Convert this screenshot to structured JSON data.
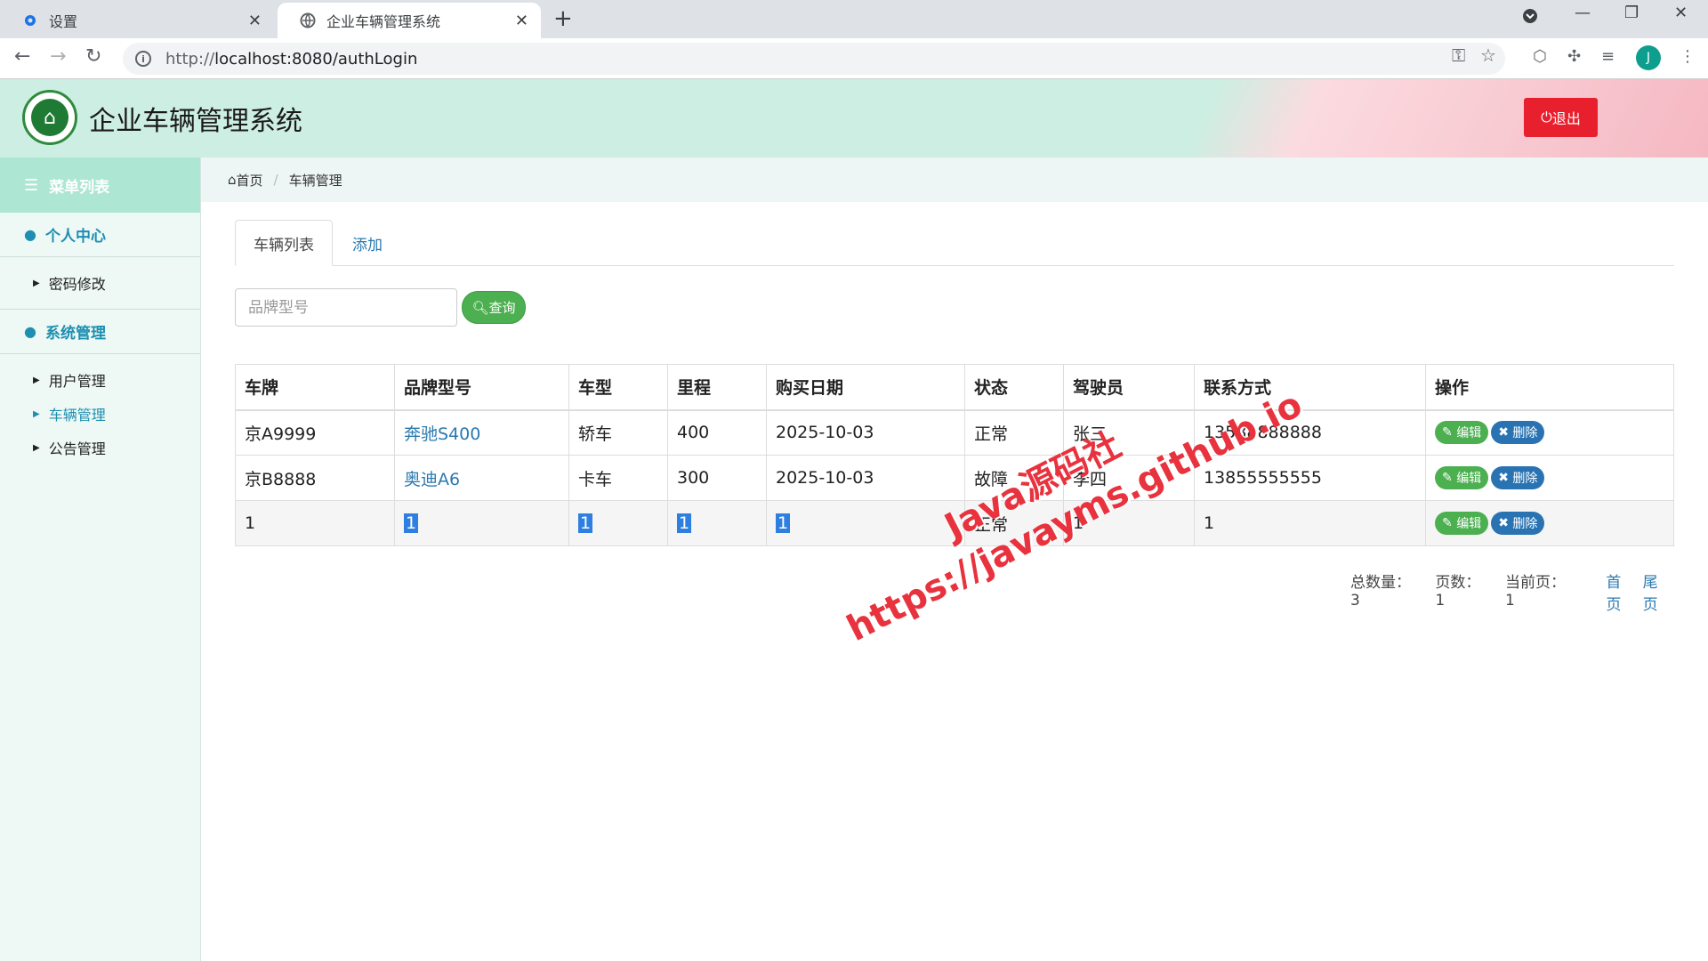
{
  "browser": {
    "tabs": [
      {
        "title": "设置",
        "icon": "gear-icon"
      },
      {
        "title": "企业车辆管理系统",
        "icon": "globe-icon"
      }
    ],
    "url_scheme": "http://",
    "url_rest": "localhost:8080/authLogin",
    "profile_initial": "J"
  },
  "header": {
    "title": "企业车辆管理系统",
    "logout_label": "退出",
    "logout_color": "#e8202e"
  },
  "sidebar": {
    "menu_title": "菜单列表",
    "groups": [
      {
        "title": "个人中心",
        "items": [
          "密码修改"
        ]
      },
      {
        "title": "系统管理",
        "items": [
          "用户管理",
          "车辆管理",
          "公告管理"
        ],
        "active": "车辆管理"
      }
    ]
  },
  "breadcrumb": {
    "home": "首页",
    "current": "车辆管理"
  },
  "content_tabs": {
    "list": "车辆列表",
    "add": "添加"
  },
  "search": {
    "placeholder": "品牌型号",
    "button": "查询"
  },
  "table": {
    "headers": [
      "车牌",
      "品牌型号",
      "车型",
      "里程",
      "购买日期",
      "状态",
      "驾驶员",
      "联系方式",
      "操作"
    ],
    "rows": [
      [
        "京A9999",
        "奔驰S400",
        "轿车",
        "400",
        "2025-10-03",
        "正常",
        "张三",
        "13588888888"
      ],
      [
        "京B8888",
        "奥迪A6",
        "卡车",
        "300",
        "2025-10-03",
        "故障",
        "李四",
        "13855555555"
      ],
      [
        "1",
        "1",
        "1",
        "1",
        "1",
        "正常",
        "1",
        "1"
      ]
    ],
    "edit_label": "编辑",
    "delete_label": "删除"
  },
  "pager": {
    "total": "总数量：3",
    "pages": "页数：1",
    "current": "当前页：1",
    "first": "首页",
    "last": "尾页"
  },
  "watermark": {
    "line1": "Java源码社",
    "line2": "https://javayms.github.io"
  }
}
